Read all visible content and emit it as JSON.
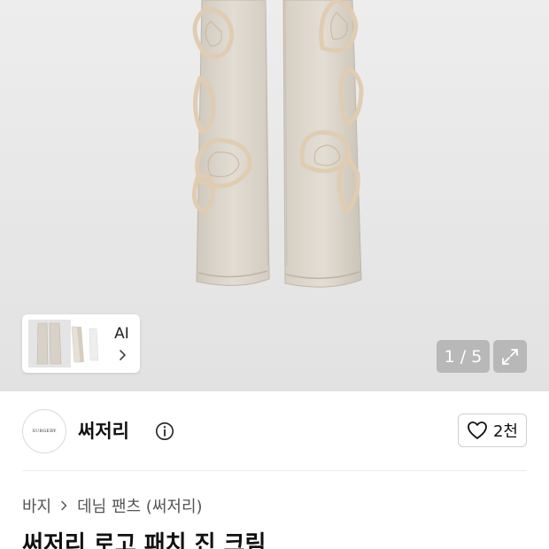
{
  "gallery": {
    "thumbnail_label": "AI",
    "counter": "1 / 5"
  },
  "brand": {
    "logo_text": "SURGERY",
    "name": "써저리",
    "like_count": "2천"
  },
  "breadcrumb": {
    "items": [
      "바지",
      "데님 팬츠 (써저리)"
    ]
  },
  "product": {
    "title": "써저리 로고 패치 진 크림"
  },
  "icons": [
    "chevron-right-icon",
    "expand-icon",
    "info-icon",
    "heart-icon"
  ],
  "colors": {
    "pants": "#ddd7cc",
    "patch": "#e6d3bb"
  }
}
